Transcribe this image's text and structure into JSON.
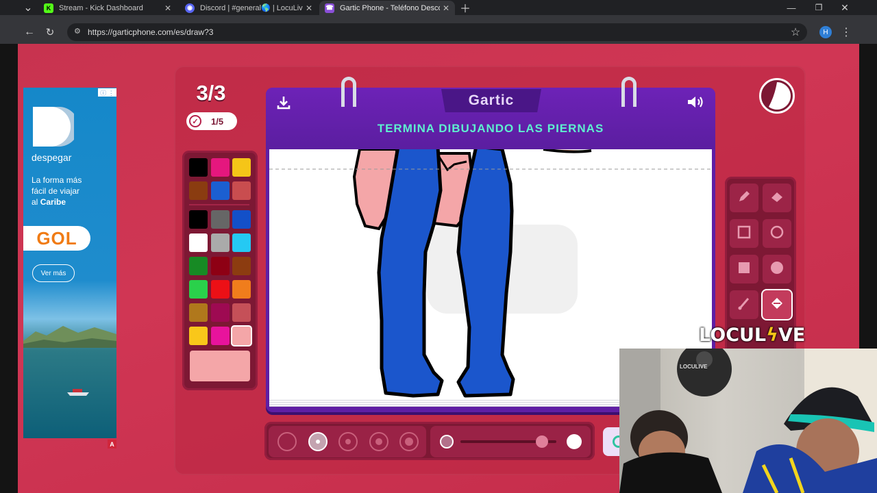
{
  "browser": {
    "tabs": [
      {
        "title": "Stream - Kick Dashboard",
        "icon": "kick-icon",
        "glyph": "K",
        "color": "#53fc18"
      },
      {
        "title": "Discord | #general🌎 | LocuLive",
        "icon": "discord-icon",
        "glyph": "◉",
        "color": "#5865f2"
      },
      {
        "title": "Gartic Phone - Teléfono Descompuesto",
        "icon": "gartic-icon",
        "glyph": "☎",
        "color": "#8a4fd8",
        "active": true
      }
    ],
    "url": "https://garticphone.com/es/draw?3",
    "profile_initial": "H"
  },
  "ad": {
    "brand": "despegar",
    "tagline_line1": "La forma más",
    "tagline_line2": "fácil de viajar",
    "tagline_line3": "al ",
    "tagline_bold": "Caribe",
    "partner": "GOL",
    "cta": "Ver más",
    "info": "ⓘ ⋮",
    "badge": "A"
  },
  "game": {
    "round": "3/3",
    "done_count": "1/5",
    "logo": "Gartic",
    "prompt": "TERMINA DIBUJANDO LAS PIERNAS",
    "palette": [
      "#000000",
      "#e5177e",
      "#f5c518",
      "#8a3c10",
      "#1b5fd1",
      "#c94d4f",
      "#000000",
      "#666666",
      "#1350c8",
      "#ffffff",
      "#aaaaaa",
      "#25c9f3",
      "#178a24",
      "#8e0014",
      "#8c3c10",
      "#2ad14b",
      "#ec1016",
      "#f07d1c",
      "#b0781c",
      "#9e0a52",
      "#c55058",
      "#f9c71a",
      "#e8139c",
      "#f4a6a8"
    ],
    "selected_color": "#f4a6a8",
    "tools": [
      "pencil-icon",
      "eraser-icon",
      "rectangle-outline-icon",
      "circle-outline-icon",
      "rectangle-filled-icon",
      "circle-filled-icon",
      "line-icon",
      "fill-bucket-icon"
    ],
    "selected_tool": "fill-bucket-icon",
    "brush_sizes": 5,
    "selected_brush": 2,
    "opacity_value": 0.85
  },
  "overlay": {
    "brand_prefix": "LOCUL",
    "brand_suffix": "VE",
    "cam_logo": "LOCULIVE"
  }
}
